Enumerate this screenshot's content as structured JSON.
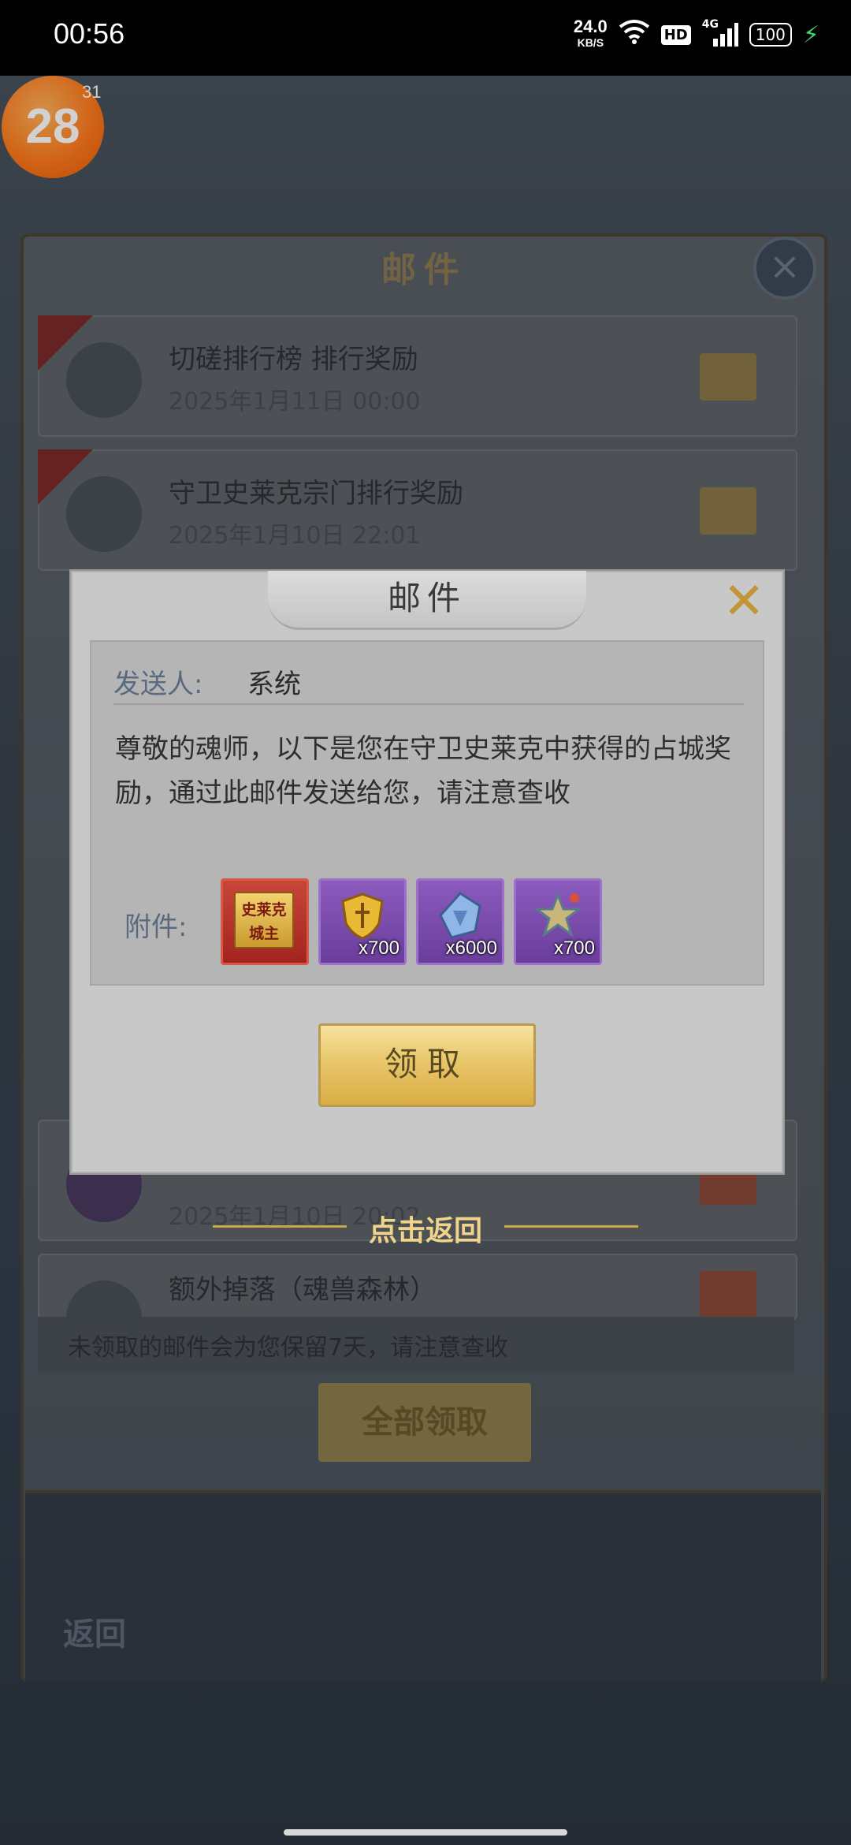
{
  "status_bar": {
    "time": "00:56",
    "net_speed": "24.0",
    "net_unit": "KB/S",
    "hd": "HD",
    "network": "4G",
    "battery": "100",
    "icons": [
      "wifi-icon",
      "signal-icon",
      "charging-icon"
    ]
  },
  "badge": {
    "level": "28",
    "count": "31"
  },
  "background": {
    "panel_title": "邮件",
    "rows": [
      {
        "title": "切磋排行榜 排行奖励",
        "date": "2025年1月11日 00:00"
      },
      {
        "title": "守卫史莱克宗门排行奖励",
        "date": "2025年1月10日 22:01"
      },
      {
        "title": "",
        "date": "2025年1月10日 20:02"
      },
      {
        "title": "额外掉落（魂兽森林）",
        "date": ""
      }
    ],
    "note": "未领取的邮件会为您保留7天，请注意查收",
    "claim_all": "全部领取",
    "back": "返回"
  },
  "modal": {
    "title": "邮件",
    "sender_label": "发送人:",
    "sender_value": "系统",
    "body": "尊敬的魂师，以下是您在守卫史莱克中获得的占城奖励，通过此邮件发送给您，请注意查收",
    "attachments_label": "附件:",
    "attachments": [
      {
        "icon": "title-plaque-icon",
        "plaque_text": "史莱克城主",
        "qty": ""
      },
      {
        "icon": "gold-shield-icon",
        "plaque_text": "",
        "qty": "x700"
      },
      {
        "icon": "contribution-crystal-icon",
        "plaque_text": "",
        "qty": "x6000"
      },
      {
        "icon": "merit-star-icon",
        "plaque_text": "",
        "qty": "x700"
      }
    ],
    "claim_button": "领取"
  },
  "return_hint": "点击返回"
}
